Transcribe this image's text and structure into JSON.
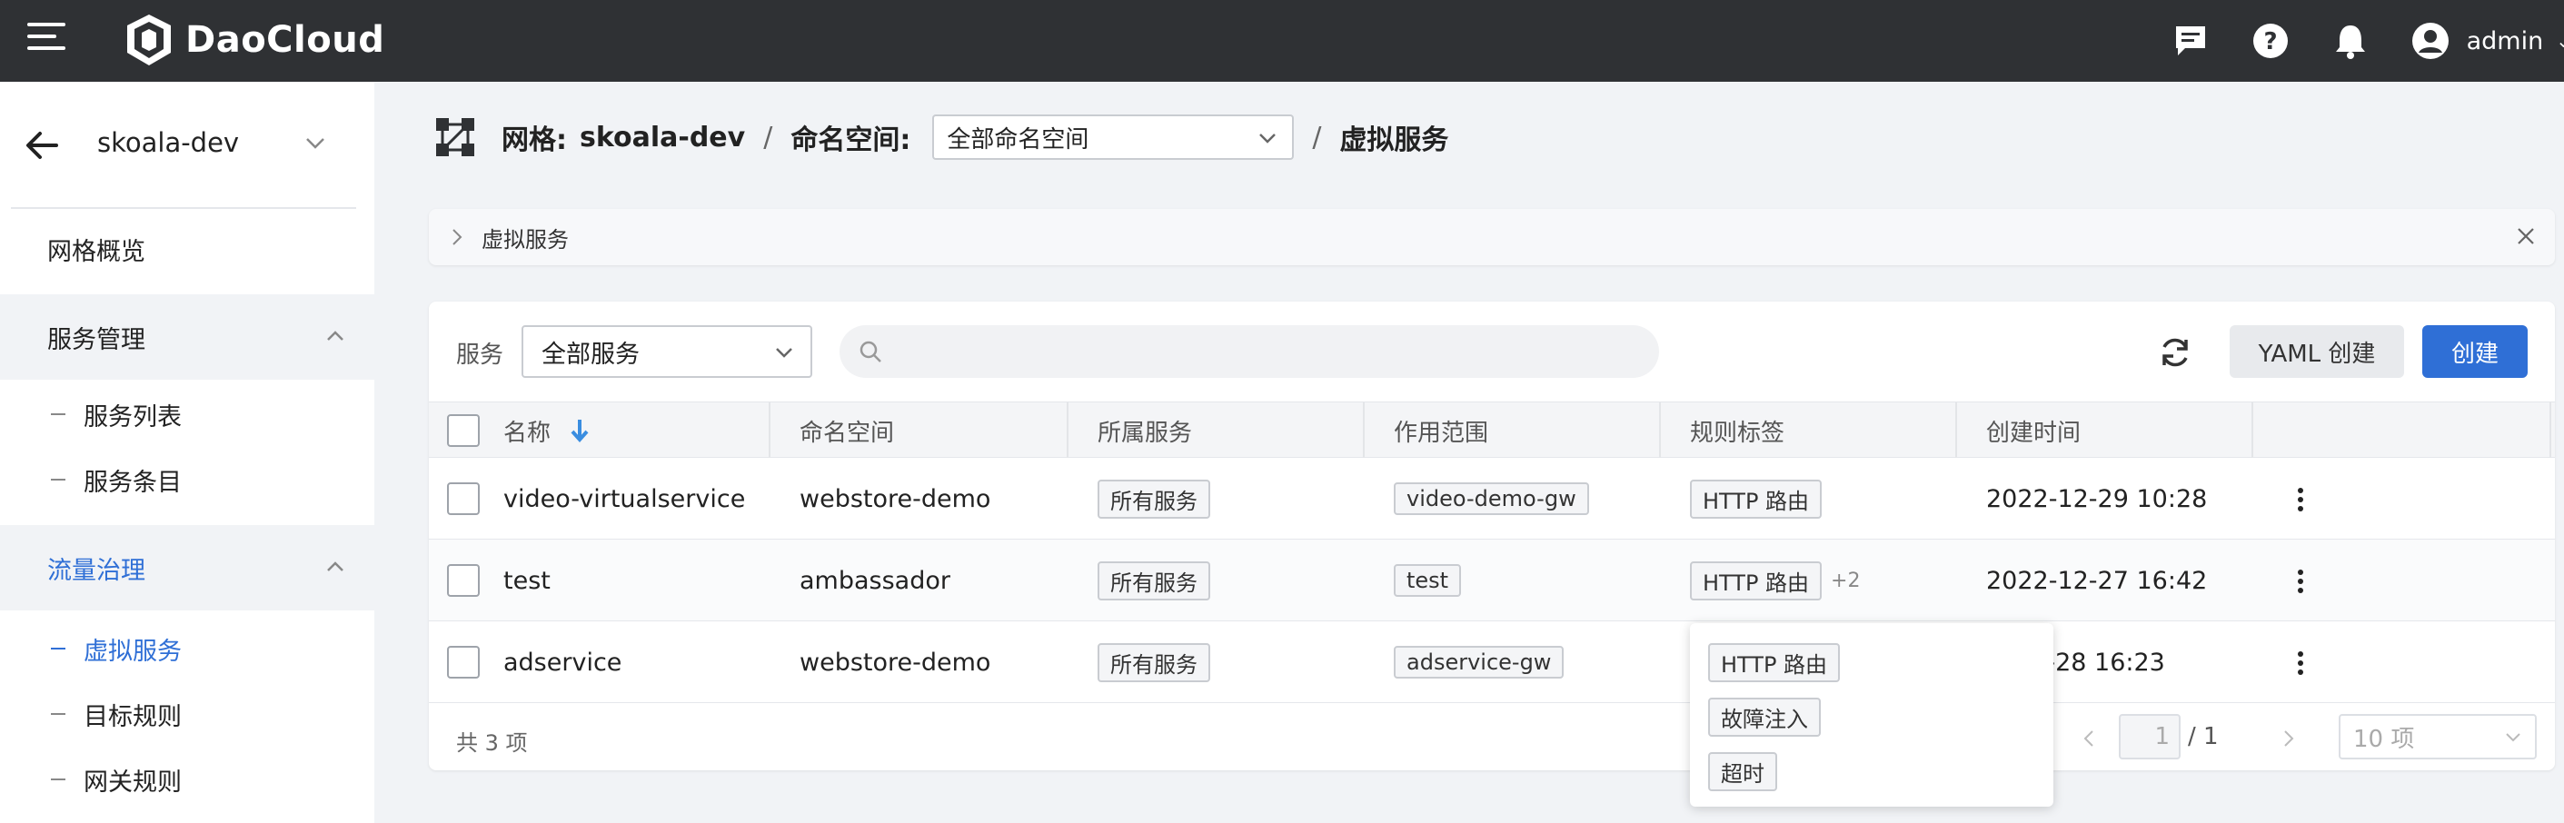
{
  "topbar": {
    "brand": "DaoCloud",
    "user_name": "admin",
    "icons": [
      "menu-icon",
      "chat-icon",
      "help-icon",
      "bell-icon",
      "user-icon"
    ]
  },
  "sidebar": {
    "mesh_name": "skoala-dev",
    "items": [
      {
        "label": "网格概览",
        "type": "item"
      },
      {
        "label": "服务管理",
        "type": "group",
        "expanded": true
      },
      {
        "label": "服务列表",
        "type": "sub"
      },
      {
        "label": "服务条目",
        "type": "sub"
      },
      {
        "label": "流量治理",
        "type": "group",
        "expanded": true,
        "active": true
      },
      {
        "label": "虚拟服务",
        "type": "sub",
        "active": true
      },
      {
        "label": "目标规则",
        "type": "sub"
      },
      {
        "label": "网关规则",
        "type": "sub"
      }
    ]
  },
  "breadcrumb": {
    "mesh_label": "网格:",
    "mesh_value": "skoala-dev",
    "sep": "/",
    "namespace_label": "命名空间:",
    "namespace_value": "全部命名空间",
    "page": "虚拟服务"
  },
  "collapse": {
    "title": "虚拟服务"
  },
  "toolbar": {
    "service_label": "服务",
    "service_value": "全部服务",
    "search_placeholder": "",
    "yaml_create": "YAML 创建",
    "create": "创建"
  },
  "table": {
    "headers": [
      "名称",
      "命名空间",
      "所属服务",
      "作用范围",
      "规则标签",
      "创建时间"
    ],
    "rows": [
      {
        "name": "video-virtualservice",
        "namespace": "webstore-demo",
        "service": "所有服务",
        "scope": "video-demo-gw",
        "rule_tag": "HTTP 路由",
        "extra": "",
        "created": "2022-12-29 10:28"
      },
      {
        "name": "test",
        "namespace": "ambassador",
        "service": "所有服务",
        "scope": "test",
        "rule_tag": "HTTP 路由",
        "extra": "+2",
        "created": "2022-12-27 16:42"
      },
      {
        "name": "adservice",
        "namespace": "webstore-demo",
        "service": "所有服务",
        "scope": "adservice-gw",
        "rule_tag": "",
        "extra": "",
        "created": "12-28 16:23"
      }
    ]
  },
  "footer": {
    "total": "共 3 项",
    "page": "1",
    "page_total": "/ 1",
    "page_size": "10 项"
  },
  "popover": {
    "tags": [
      "HTTP 路由",
      "故障注入",
      "超时"
    ]
  },
  "colors": {
    "accent": "#2f6fd6",
    "topbar": "#2f3134"
  }
}
